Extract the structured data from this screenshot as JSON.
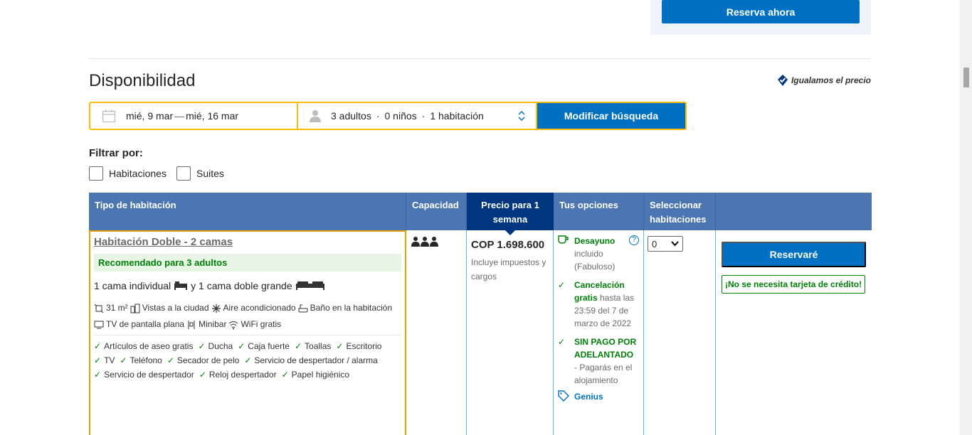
{
  "header": {
    "reserve_now": "Reserva ahora"
  },
  "availability": {
    "title": "Disponibilidad",
    "price_match": "Igualamos el precio"
  },
  "search": {
    "check_in": "mié, 9 mar",
    "separator": "—",
    "check_out": "mié, 16 mar",
    "adults": "3 adultos",
    "children": "0 niños",
    "rooms": "1 habitación",
    "dot": "·",
    "modify_label": "Modificar búsqueda"
  },
  "filters": {
    "label": "Filtrar por:",
    "options": [
      "Habitaciones",
      "Suites"
    ]
  },
  "table": {
    "headers": {
      "room_type": "Tipo de habitación",
      "capacity": "Capacidad",
      "price": "Precio para 1 semana",
      "options": "Tus opciones",
      "select": "Seleccionar habitaciones"
    },
    "room": {
      "name": "Habitación Doble - 2 camas",
      "recommended": "Recomendado para 3 adultos",
      "bed_single": "1 cama individual",
      "bed_and": "y 1 cama doble grande",
      "facilities": [
        "31 m²",
        "Vistas a la ciudad",
        "Aire acondicionado",
        "Baño en la habitación",
        "TV de pantalla plana",
        "Minibar",
        "WiFi gratis"
      ],
      "amenities": [
        "Artículos de aseo gratis",
        "Ducha",
        "Caja fuerte",
        "Toallas",
        "Escritorio",
        "TV",
        "Teléfono",
        "Secador de pelo",
        "Servicio de despertador / alarma",
        "Servicio de despertador",
        "Reloj despertador",
        "Papel higiénico"
      ],
      "capacity_adults": 3,
      "price": "COP 1.698.600",
      "price_note": "Incluye impuestos y cargos",
      "breakfast_title": "Desayuno",
      "breakfast_rest": "incluido (Fabuloso)",
      "cancel_title": "Cancelación gratis",
      "cancel_rest": "hasta las 23:59 del 7 de marzo de 2022",
      "nopay_title": "SIN PAGO POR ADELANTADO",
      "nopay_rest": "- Pagarás en el alojamiento",
      "genius": "Genius",
      "select_value": "0",
      "book_label": "Reservaré",
      "no_card": "¡No se necesita tarjeta de crédito!"
    }
  },
  "colors": {
    "primary": "#0071c2",
    "dark_blue": "#003580",
    "header_blue": "#4c76b2",
    "highlight": "#febb02",
    "green": "#008009"
  }
}
